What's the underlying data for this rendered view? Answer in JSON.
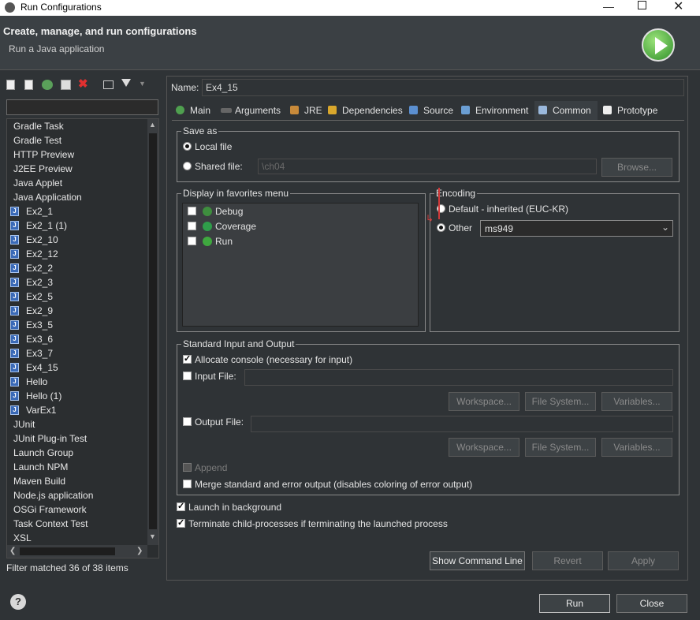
{
  "window": {
    "title": "Run Configurations"
  },
  "header": {
    "title": "Create, manage, and run configurations",
    "subtitle": "Run a Java application"
  },
  "sidebar": {
    "filter_value": "",
    "items": [
      "Gradle Task",
      "Gradle Test",
      "HTTP Preview",
      "J2EE Preview",
      "Java Applet",
      "Java Application",
      "Ex2_1",
      "Ex2_1 (1)",
      "Ex2_10",
      "Ex2_12",
      "Ex2_2",
      "Ex2_3",
      "Ex2_5",
      "Ex2_9",
      "Ex3_5",
      "Ex3_6",
      "Ex3_7",
      "Ex4_15",
      "Hello",
      "Hello (1)",
      "VarEx1",
      "JUnit",
      "JUnit Plug-in Test",
      "Launch Group",
      "Launch NPM",
      "Maven Build",
      "Node.js application",
      "OSGi Framework",
      "Task Context Test",
      "XSL"
    ],
    "status": "Filter matched 36 of 38 items"
  },
  "name": {
    "label": "Name:",
    "value": "Ex4_15"
  },
  "tabs": [
    "Main",
    "Arguments",
    "JRE",
    "Dependencies",
    "Source",
    "Environment",
    "Common",
    "Prototype"
  ],
  "save_as": {
    "legend": "Save as",
    "local_file": "Local file",
    "shared_file": "Shared file:",
    "shared_value": "\\ch04",
    "browse": "Browse..."
  },
  "favorites": {
    "legend": "Display in favorites menu",
    "items": [
      "Debug",
      "Coverage",
      "Run"
    ]
  },
  "encoding": {
    "legend": "Encoding",
    "default_label": "Default - inherited (EUC-KR)",
    "other_label": "Other",
    "other_value": "ms949"
  },
  "std_io": {
    "legend": "Standard Input and Output",
    "allocate_console": "Allocate console (necessary for input)",
    "input_file": "Input File:",
    "output_file": "Output File:",
    "workspace": "Workspace...",
    "file_system": "File System...",
    "variables": "Variables...",
    "append": "Append",
    "merge": "Merge standard and error output (disables coloring of error output)"
  },
  "launch_background": "Launch in background",
  "terminate_children": "Terminate child-processes if terminating the launched process",
  "buttons": {
    "show_command_line": "Show Command Line",
    "revert": "Revert",
    "apply": "Apply",
    "run": "Run",
    "close": "Close"
  }
}
